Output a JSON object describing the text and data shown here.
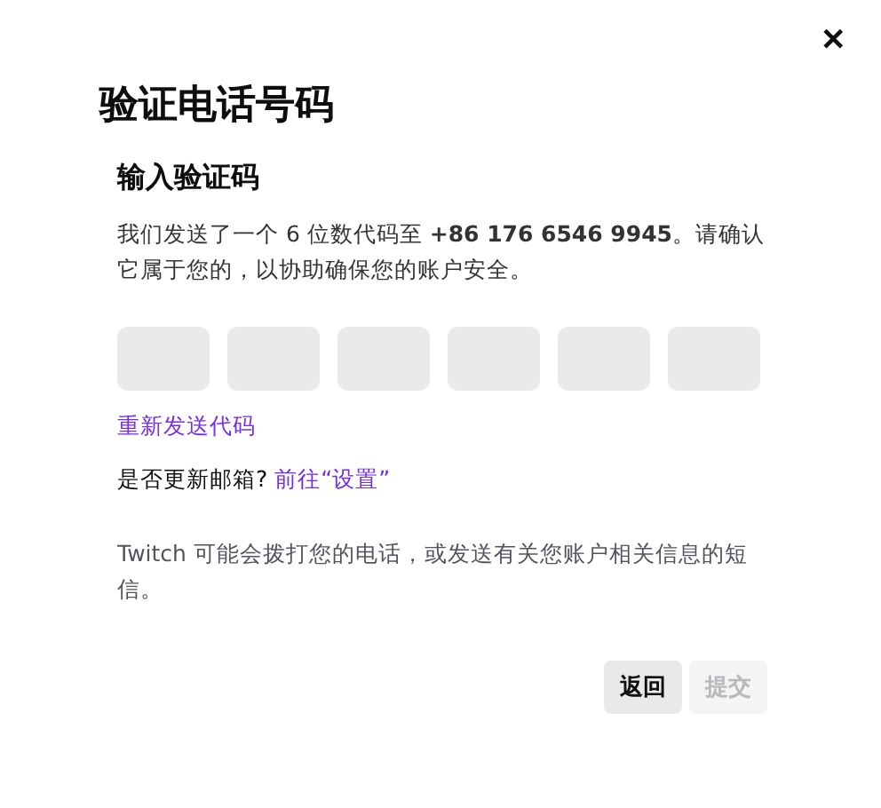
{
  "dialog": {
    "title": "验证电话号码",
    "close_icon": "✕"
  },
  "section": {
    "heading": "输入验证码",
    "description": "我们发送了一个 6 位数代码至 **+86 176 6546 9945**。请确认它属于您的，以协助确保您的账户安全。"
  },
  "code_fields": [
    {
      "focused": false
    },
    {
      "focused": false
    },
    {
      "focused": false
    },
    {
      "focused": false
    },
    {
      "focused": false
    },
    {
      "focused": false
    }
  ],
  "resend_link": "重新发送代码",
  "email_prompt": {
    "question": "是否更新邮箱?",
    "link": "前往“设置”"
  },
  "notice": "Twitch 可能会拨打您的电话，或发送有关您账户相关信息的短信。",
  "buttons": [
    {
      "label": "返回",
      "disabled": false
    },
    {
      "label": "提交",
      "disabled": true
    }
  ]
}
